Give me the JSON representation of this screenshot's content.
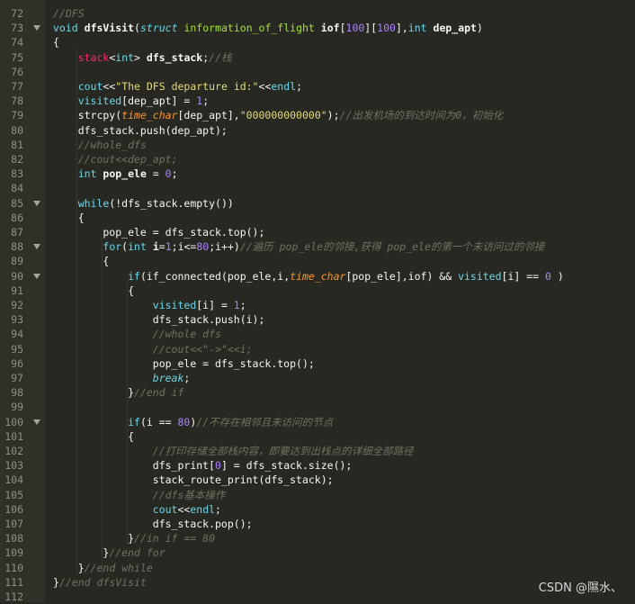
{
  "editor": {
    "colors": {
      "background": "#272822",
      "gutter": "#2f3129",
      "line_number": "#8f908a",
      "comment": "#75715e",
      "keyword": "#66d9ef",
      "number": "#ae81ff",
      "string": "#e6db74"
    },
    "lines": [
      {
        "num": "72",
        "fold": false,
        "html": "<span class=\"c\">//DFS</span>"
      },
      {
        "num": "73",
        "fold": true,
        "html": "<span class=\"kw\">void</span> <span class=\"fn\">dfsVisit</span>(<span class=\"k\">struct</span> <span class=\"t\">information_of_flight</span> <span class=\"b\">iof</span>[<span class=\"n\">100</span>][<span class=\"n\">100</span>],<span class=\"kw\">int</span> <span class=\"b\">dep_apt</span>)"
      },
      {
        "num": "74",
        "fold": false,
        "html": "{"
      },
      {
        "num": "75",
        "fold": false,
        "html": "    <span class=\"o\">stack</span>&lt;<span class=\"kw\">int</span>&gt; <span class=\"b\">dfs_stack</span>;<span class=\"c\">//栈</span>"
      },
      {
        "num": "76",
        "fold": false,
        "html": ""
      },
      {
        "num": "77",
        "fold": false,
        "html": "    <span class=\"i\">cout</span>&lt;&lt;<span class=\"s\">\"The DFS departure id:\"</span>&lt;&lt;<span class=\"i\">endl</span>;"
      },
      {
        "num": "78",
        "fold": false,
        "html": "    <span class=\"i\">visited</span>[dep_apt] = <span class=\"n\">1</span>;"
      },
      {
        "num": "79",
        "fold": false,
        "html": "    strcpy(<span class=\"p\">time_char</span>[dep_apt],<span class=\"s\">\"000000000000\"</span>);<span class=\"c\">//出发机场的到达时间为0，初始化</span>"
      },
      {
        "num": "80",
        "fold": false,
        "html": "    dfs_stack.push(dep_apt);"
      },
      {
        "num": "81",
        "fold": false,
        "html": "    <span class=\"c\">//whole_dfs</span>"
      },
      {
        "num": "82",
        "fold": false,
        "html": "    <span class=\"c\">//cout&lt;&lt;dep_apt;</span>"
      },
      {
        "num": "83",
        "fold": false,
        "html": "    <span class=\"kw\">int</span> <span class=\"b\">pop_ele</span> = <span class=\"n\">0</span>;"
      },
      {
        "num": "84",
        "fold": false,
        "html": ""
      },
      {
        "num": "85",
        "fold": true,
        "html": "    <span class=\"kw\">while</span>(!dfs_stack.empty())"
      },
      {
        "num": "86",
        "fold": false,
        "html": "    {"
      },
      {
        "num": "87",
        "fold": false,
        "html": "        pop_ele = dfs_stack.top();"
      },
      {
        "num": "88",
        "fold": true,
        "html": "        <span class=\"kw\">for</span>(<span class=\"kw\">int</span> <span class=\"b\">i</span>=<span class=\"n\">1</span>;i&lt;=<span class=\"n\">80</span>;i++)<span class=\"c\">//遍历 pop_ele的邻接,获得 pop_ele的第一个未访问过的邻接</span>"
      },
      {
        "num": "89",
        "fold": false,
        "html": "        {"
      },
      {
        "num": "90",
        "fold": true,
        "html": "            <span class=\"kw\">if</span>(if_connected(pop_ele,i,<span class=\"p\">time_char</span>[pop_ele],iof) &amp;&amp; <span class=\"i\">visited</span>[i] == <span class=\"n\">0</span> )"
      },
      {
        "num": "91",
        "fold": false,
        "html": "            {"
      },
      {
        "num": "92",
        "fold": false,
        "html": "                <span class=\"i\">visited</span>[i] = <span class=\"n\">1</span>;"
      },
      {
        "num": "93",
        "fold": false,
        "html": "                dfs_stack.push(i);"
      },
      {
        "num": "94",
        "fold": false,
        "html": "                <span class=\"c\">//whole dfs</span>"
      },
      {
        "num": "95",
        "fold": false,
        "html": "                <span class=\"c\">//cout&lt;&lt;\"-&gt;\"&lt;&lt;i;</span>"
      },
      {
        "num": "96",
        "fold": false,
        "html": "                pop_ele = dfs_stack.top();"
      },
      {
        "num": "97",
        "fold": false,
        "html": "                <span class=\"k\">break</span>;"
      },
      {
        "num": "98",
        "fold": false,
        "html": "            }<span class=\"c\">//end if</span>"
      },
      {
        "num": "99",
        "fold": false,
        "html": ""
      },
      {
        "num": "100",
        "fold": true,
        "html": "            <span class=\"kw\">if</span>(i == <span class=\"n\">80</span>)<span class=\"c\">//不存在相邻且未访问的节点</span>"
      },
      {
        "num": "101",
        "fold": false,
        "html": "            {"
      },
      {
        "num": "102",
        "fold": false,
        "html": "                <span class=\"c\">//打印存储全部栈内容，即要达到出栈点的详细全部路径</span>"
      },
      {
        "num": "103",
        "fold": false,
        "html": "                dfs_print[<span class=\"n\">0</span>] = dfs_stack.size();"
      },
      {
        "num": "104",
        "fold": false,
        "html": "                stack_route_print(dfs_stack);"
      },
      {
        "num": "105",
        "fold": false,
        "html": "                <span class=\"c\">//dfs基本操作</span>"
      },
      {
        "num": "106",
        "fold": false,
        "html": "                <span class=\"i\">cout</span>&lt;&lt;<span class=\"i\">endl</span>;"
      },
      {
        "num": "107",
        "fold": false,
        "html": "                dfs_stack.pop();"
      },
      {
        "num": "108",
        "fold": false,
        "html": "            }<span class=\"c\">//in if == 80</span>"
      },
      {
        "num": "109",
        "fold": false,
        "html": "        }<span class=\"c\">//end for</span>"
      },
      {
        "num": "110",
        "fold": false,
        "html": "    }<span class=\"c\">//end while</span>"
      },
      {
        "num": "111",
        "fold": false,
        "html": "}<span class=\"c\">//end dfsVisit</span>"
      },
      {
        "num": "112",
        "fold": false,
        "html": ""
      }
    ]
  },
  "watermark": {
    "text": "CSDN @隰水、"
  }
}
